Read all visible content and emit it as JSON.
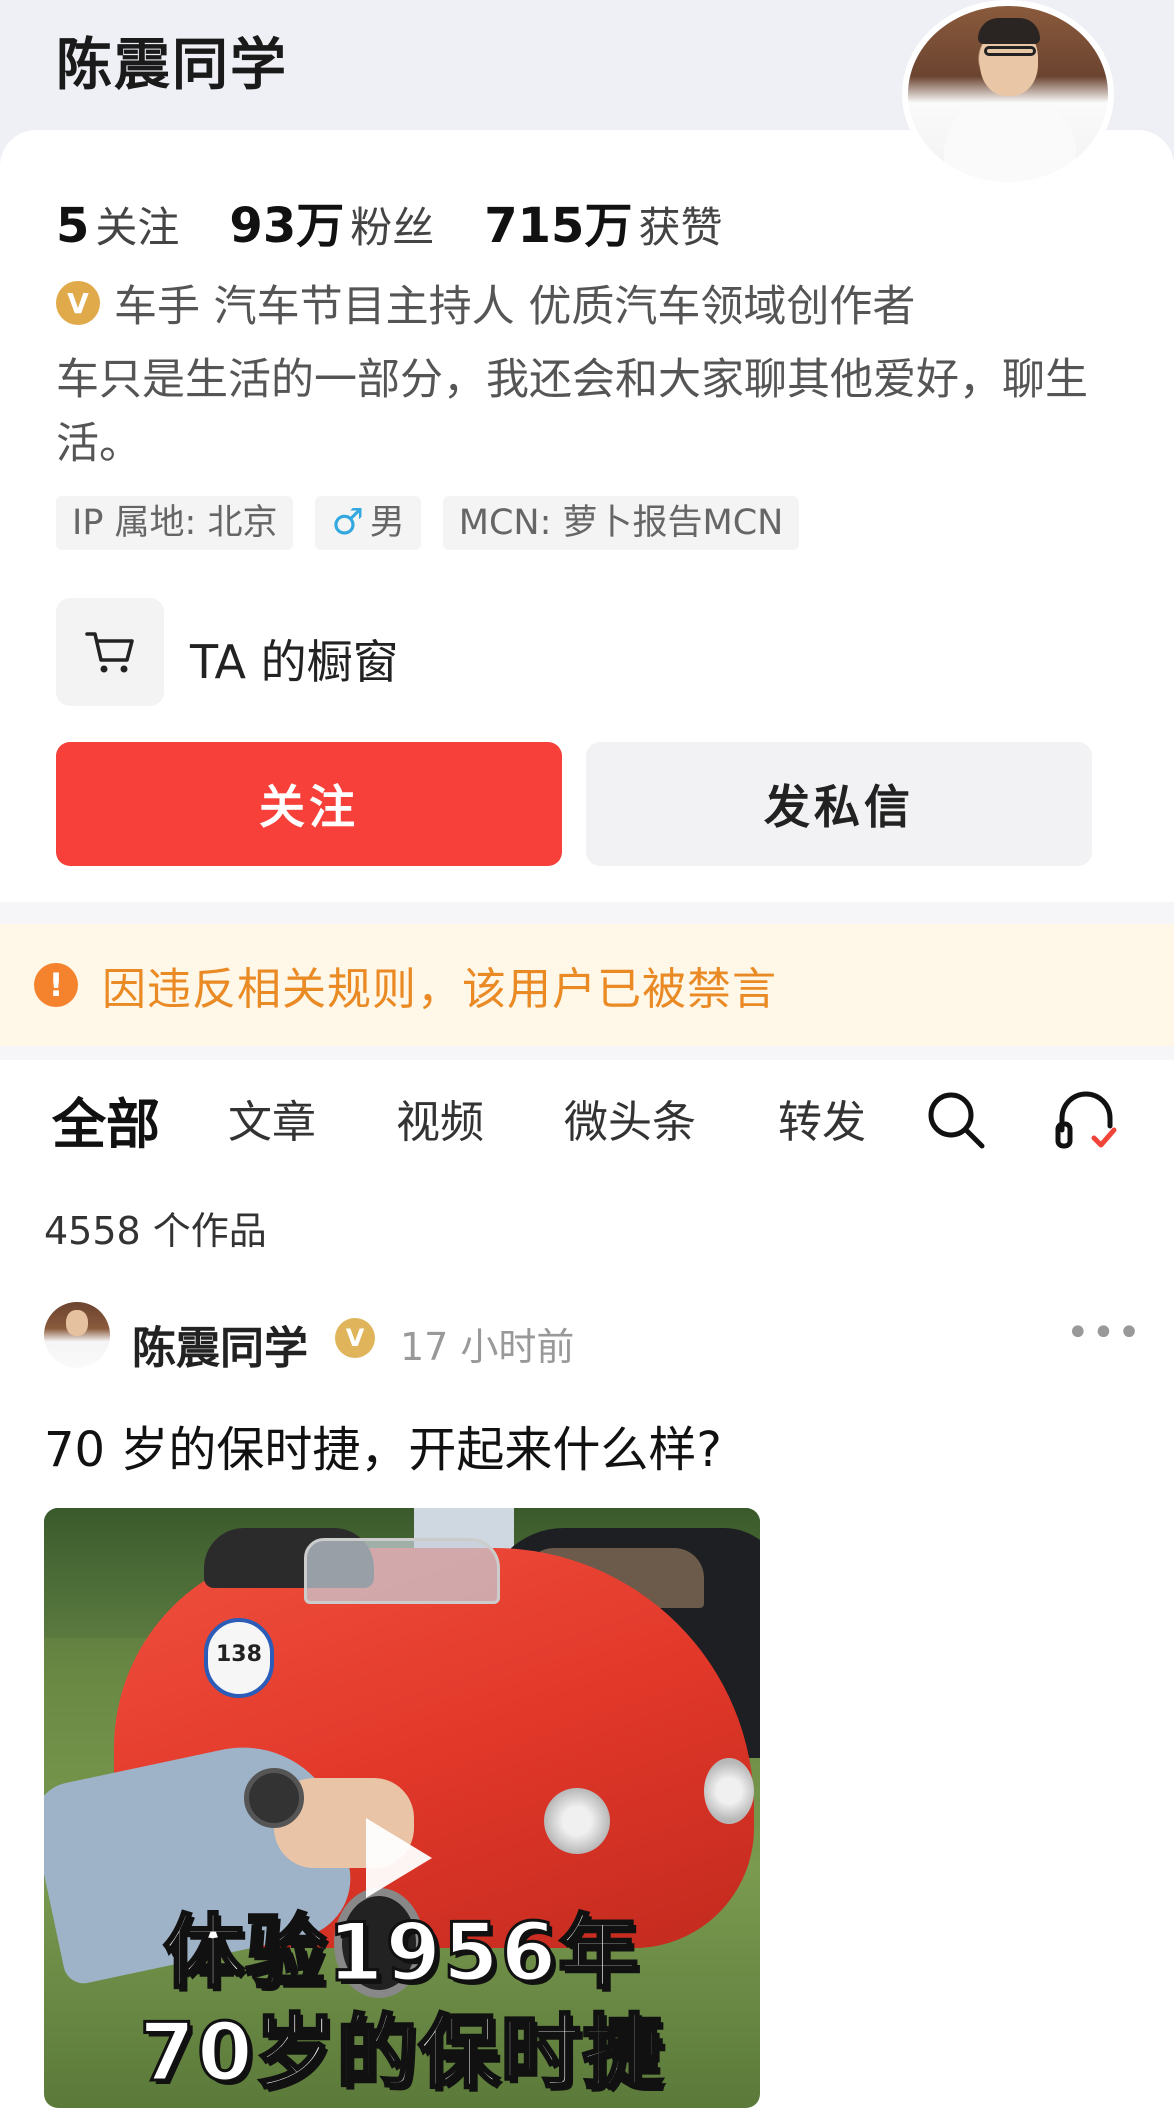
{
  "header": {
    "title": "陈震同学"
  },
  "profile": {
    "stats": [
      {
        "num": "5",
        "label": "关注"
      },
      {
        "num": "93万",
        "label": "粉丝"
      },
      {
        "num": "715万",
        "label": "获赞"
      }
    ],
    "verify_badge": "V",
    "verify_text": "车手 汽车节目主持人 优质汽车领域创作者",
    "bio": "车只是生活的一部分，我还会和大家聊其他爱好，聊生活。",
    "tags": {
      "ip": "IP 属地: 北京",
      "gender_symbol": "♂",
      "gender": "男",
      "mcn": "MCN: 萝卜报告MCN"
    },
    "shop_label": "TA 的橱窗"
  },
  "actions": {
    "follow_label": "关注",
    "message_label": "发私信",
    "follow_color": "#f7403a"
  },
  "notice": {
    "icon": "!",
    "text": "因违反相关规则，该用户已被禁言",
    "color": "#ea8a24"
  },
  "tabs": [
    {
      "label": "全部",
      "active": true
    },
    {
      "label": "文章",
      "active": false
    },
    {
      "label": "视频",
      "active": false
    },
    {
      "label": "微头条",
      "active": false
    },
    {
      "label": "转发",
      "active": false
    }
  ],
  "tab_icons": [
    "search-icon",
    "headphones-icon"
  ],
  "works_count": "4558 个作品",
  "post": {
    "author": "陈震同学",
    "verify_badge": "V",
    "time": "17 小时前",
    "more": "•••",
    "title": "70 岁的保时捷，开起来什么样?",
    "thumbnail": {
      "roundel_number": "138",
      "caption_line1": "体验1956年",
      "caption_line2": "70岁的保时捷"
    }
  }
}
